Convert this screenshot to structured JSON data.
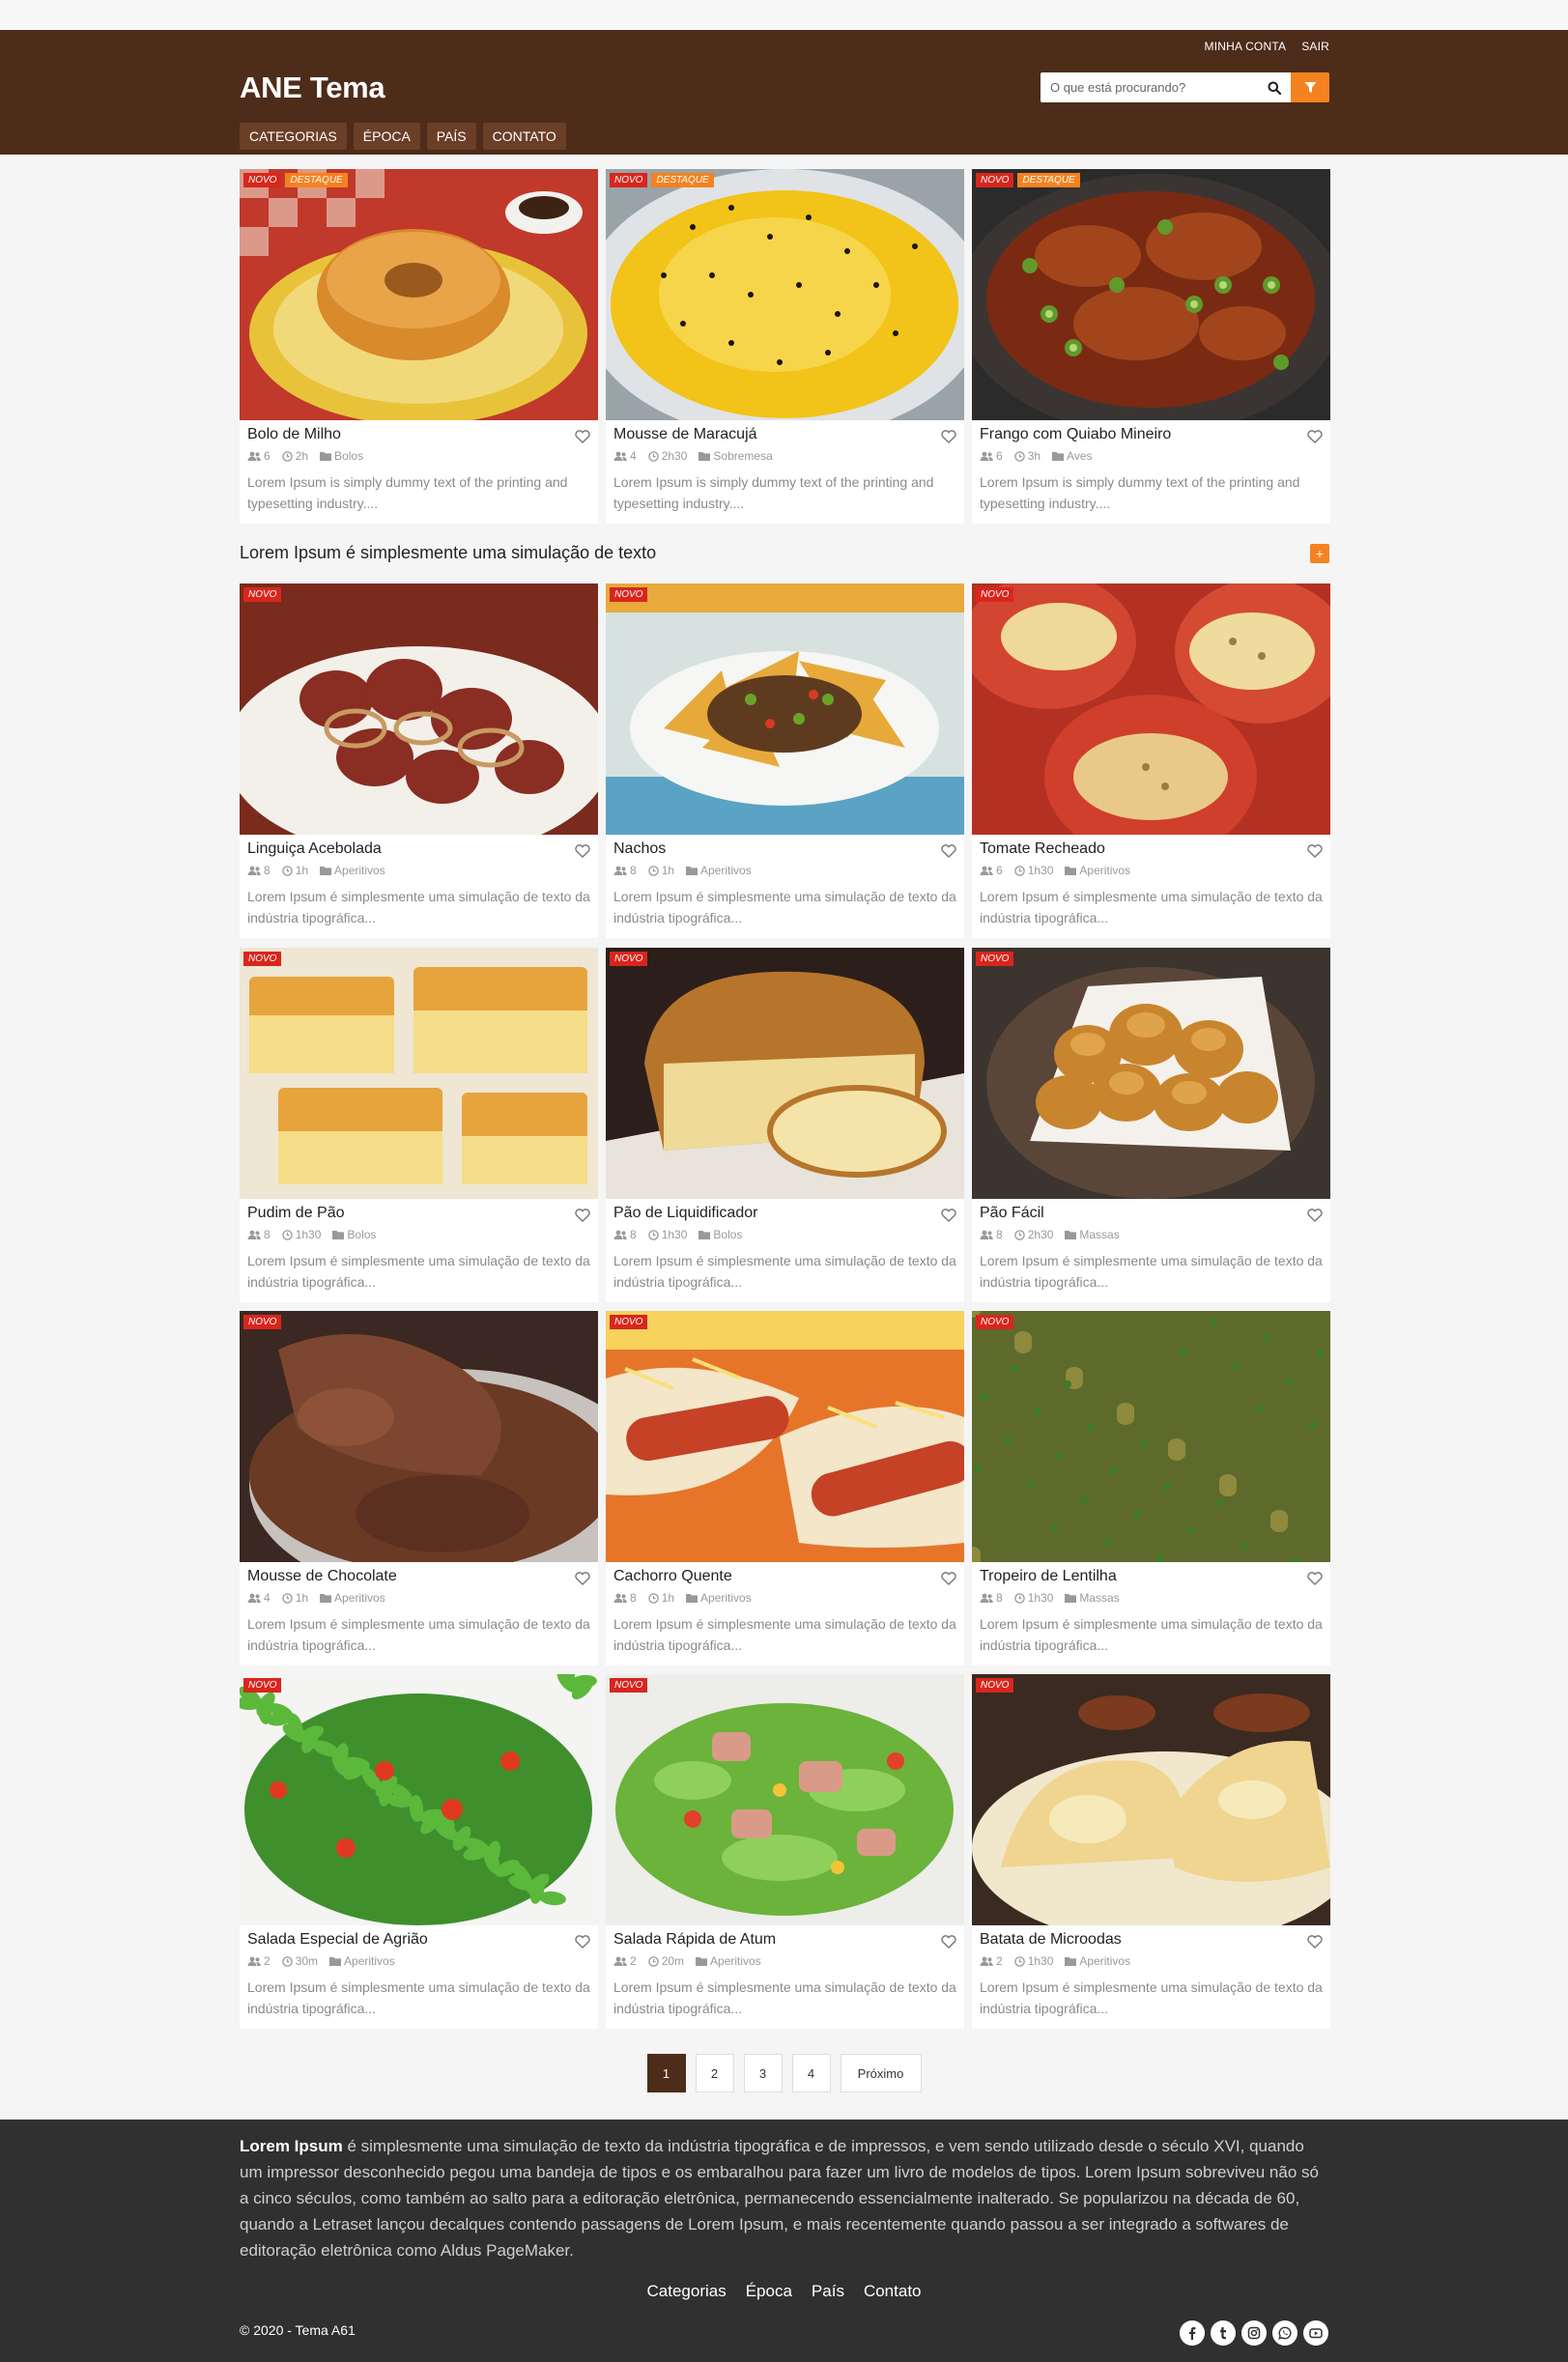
{
  "header": {
    "account_link": "MINHA CONTA",
    "logout_link": "SAIR",
    "brand": "ANE Tema",
    "search_placeholder": "O que está procurando?",
    "nav": [
      "CATEGORIAS",
      "ÉPOCA",
      "PAÍS",
      "CONTATO"
    ]
  },
  "badges": {
    "new": "NOVO",
    "featured": "DESTAQUE"
  },
  "featured": [
    {
      "title": "Bolo de Milho",
      "servings": "6",
      "time": "2h",
      "category": "Bolos",
      "desc": "Lorem Ipsum is simply dummy text of the printing and typesetting industry...."
    },
    {
      "title": "Mousse de Maracujá",
      "servings": "4",
      "time": "2h30",
      "category": "Sobremesa",
      "desc": "Lorem Ipsum is simply dummy text of the printing and typesetting industry...."
    },
    {
      "title": "Frango com Quiabo Mineiro",
      "servings": "6",
      "time": "3h",
      "category": "Aves",
      "desc": "Lorem Ipsum is simply dummy text of the printing and typesetting industry...."
    }
  ],
  "section": {
    "title": "Lorem Ipsum é simplesmente uma simulação de texto",
    "more": "+"
  },
  "recipes": [
    {
      "title": "Linguiça Acebolada",
      "servings": "8",
      "time": "1h",
      "category": "Aperitivos",
      "desc": "Lorem Ipsum é simplesmente uma simulação de texto da indústria tipográfica..."
    },
    {
      "title": "Nachos",
      "servings": "8",
      "time": "1h",
      "category": "Aperitivos",
      "desc": "Lorem Ipsum é simplesmente uma simulação de texto da indústria tipográfica..."
    },
    {
      "title": "Tomate Recheado",
      "servings": "6",
      "time": "1h30",
      "category": "Aperitivos",
      "desc": "Lorem Ipsum é simplesmente uma simulação de texto da indústria tipográfica..."
    },
    {
      "title": "Pudim de Pão",
      "servings": "8",
      "time": "1h30",
      "category": "Bolos",
      "desc": "Lorem Ipsum é simplesmente uma simulação de texto da indústria tipográfica..."
    },
    {
      "title": "Pão de Liquidificador",
      "servings": "8",
      "time": "1h30",
      "category": "Bolos",
      "desc": "Lorem Ipsum é simplesmente uma simulação de texto da indústria tipográfica..."
    },
    {
      "title": "Pão Fácil",
      "servings": "8",
      "time": "2h30",
      "category": "Massas",
      "desc": "Lorem Ipsum é simplesmente uma simulação de texto da indústria tipográfica..."
    },
    {
      "title": "Mousse de Chocolate",
      "servings": "4",
      "time": "1h",
      "category": "Aperitivos",
      "desc": "Lorem Ipsum é simplesmente uma simulação de texto da indústria tipográfica..."
    },
    {
      "title": "Cachorro Quente",
      "servings": "8",
      "time": "1h",
      "category": "Aperitivos",
      "desc": "Lorem Ipsum é simplesmente uma simulação de texto da indústria tipográfica..."
    },
    {
      "title": "Tropeiro de Lentilha",
      "servings": "8",
      "time": "1h30",
      "category": "Massas",
      "desc": "Lorem Ipsum é simplesmente uma simulação de texto da indústria tipográfica..."
    },
    {
      "title": "Salada Especial de Agrião",
      "servings": "2",
      "time": "30m",
      "category": "Aperitivos",
      "desc": "Lorem Ipsum é simplesmente uma simulação de texto da indústria tipográfica..."
    },
    {
      "title": "Salada Rápida de Atum",
      "servings": "2",
      "time": "20m",
      "category": "Aperitivos",
      "desc": "Lorem Ipsum é simplesmente uma simulação de texto da indústria tipográfica..."
    },
    {
      "title": "Batata de Microodas",
      "servings": "2",
      "time": "1h30",
      "category": "Aperitivos",
      "desc": "Lorem Ipsum é simplesmente uma simulação de texto da indústria tipográfica..."
    }
  ],
  "pagination": {
    "pages": [
      "1",
      "2",
      "3",
      "4"
    ],
    "next": "Próximo"
  },
  "footer": {
    "about_bold": "Lorem Ipsum",
    "about_text": " é simplesmente uma simulação de texto da indústria tipográfica e de impressos, e vem sendo utilizado desde o século XVI, quando um impressor desconhecido pegou uma bandeja de tipos e os embaralhou para fazer um livro de modelos de tipos. Lorem Ipsum sobreviveu não só a cinco séculos, como também ao salto para a editoração eletrônica, permanecendo essencialmente inalterado. Se popularizou na década de 60, quando a Letraset lançou decalques contendo passagens de Lorem Ipsum, e mais recentemente quando passou a ser integrado a softwares de editoração eletrônica como Aldus PageMaker.",
    "nav": [
      "Categorias",
      "Época",
      "País",
      "Contato"
    ],
    "copyright": "© 2020 - Tema A61",
    "socials": [
      "facebook-icon",
      "tumblr-icon",
      "instagram-icon",
      "whatsapp-icon",
      "youtube-icon"
    ]
  },
  "colors": {
    "header": "#4d2c1a",
    "nav_button": "#6b3f26",
    "accent": "#f58220",
    "badge": "#d9261c",
    "footer": "#303030"
  }
}
